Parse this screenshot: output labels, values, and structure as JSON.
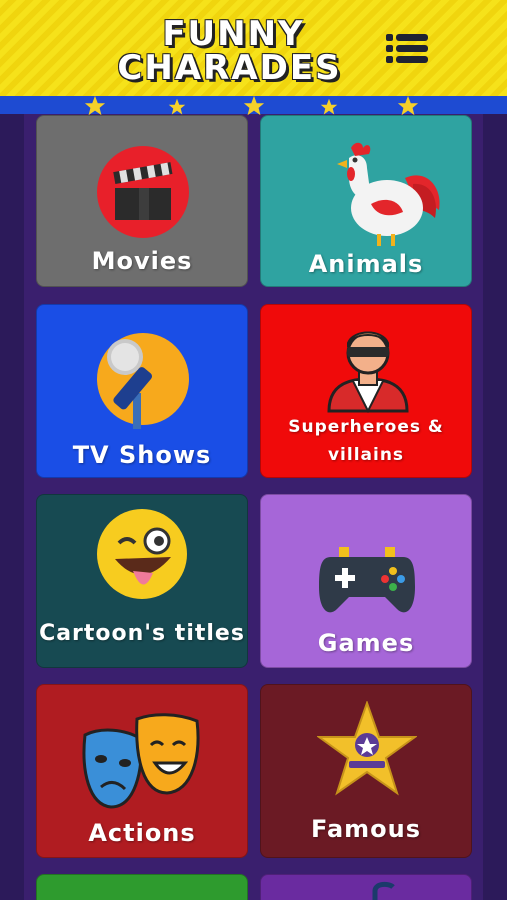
{
  "header": {
    "title_line1": "FUNNY",
    "title_line2": "CHARADES",
    "menu_icon": "menu-icon",
    "colors": {
      "banner": "#f4dc16",
      "stripe": "#1e4bd2",
      "star": "#f5d02a"
    }
  },
  "categories": [
    {
      "label": "Movies",
      "icon": "clapperboard-icon",
      "color": "#6e6e6e"
    },
    {
      "label": "Animals",
      "icon": "rooster-icon",
      "color": "#2fa3a1"
    },
    {
      "label": "TV Shows",
      "icon": "microphone-icon",
      "color": "#1a4ee6"
    },
    {
      "label_line1": "Superheroes &",
      "label_line2": "villains",
      "icon": "masked-hero-icon",
      "color": "#f00a0a"
    },
    {
      "label": "Cartoon's titles",
      "icon": "winking-emoji-icon",
      "color": "#174a52"
    },
    {
      "label": "Games",
      "icon": "gamepad-icon",
      "color": "#a666d8"
    },
    {
      "label": "Actions",
      "icon": "theater-masks-icon",
      "color": "#b01c21"
    },
    {
      "label": "Famous",
      "icon": "star-award-icon",
      "color": "#6b1a24"
    },
    {
      "label": "",
      "icon": "",
      "color": "#2e9b2e"
    },
    {
      "label": "",
      "icon": "",
      "color": "#6a2ba0"
    }
  ]
}
